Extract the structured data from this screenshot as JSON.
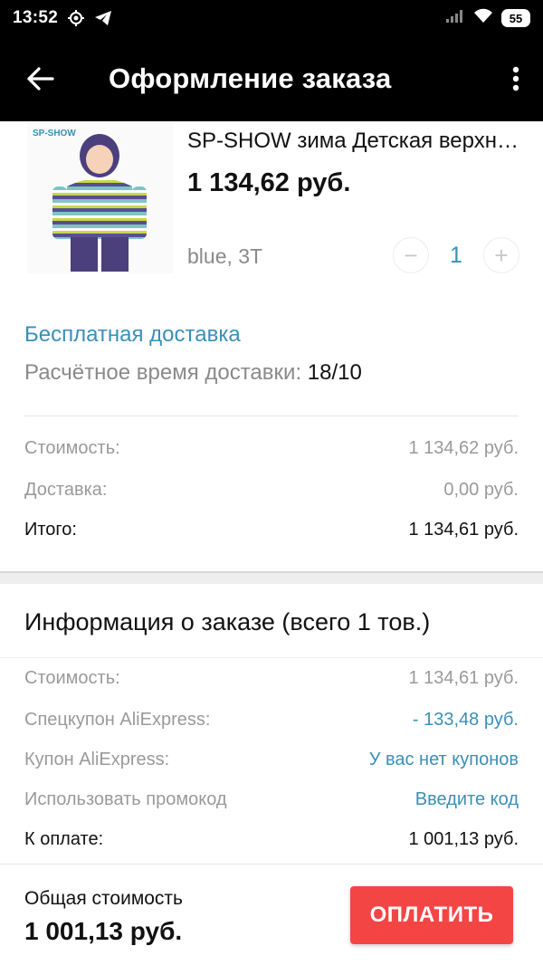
{
  "status_bar": {
    "time": "13:52",
    "battery": "55",
    "icons": [
      "settings-gear-icon",
      "telegram-icon",
      "signal-icon",
      "wifi-icon",
      "battery-icon"
    ]
  },
  "app_bar": {
    "title": "Оформление заказа",
    "back_icon": "arrow-left-icon",
    "more_icon": "more-vertical-icon"
  },
  "product": {
    "brand_logo_text": "SP-SHOW",
    "name": "SP-SHOW зима Детская верхняя одежда",
    "price": "1 134,62 руб.",
    "variant": "blue, 3T",
    "quantity": "1",
    "minus": "−",
    "plus": "+"
  },
  "shipping": {
    "method": "Бесплатная доставка",
    "eta_label": "Расчётное время доставки:",
    "eta_value": "18/10"
  },
  "item_summary": {
    "cost_label": "Стоимость:",
    "cost_value": "1 134,62 руб.",
    "delivery_label": "Доставка:",
    "delivery_value": "0,00 руб.",
    "total_label": "Итого:",
    "total_value": "1 134,61 руб."
  },
  "order_info": {
    "title": "Информация о заказе (всего 1 тов.)",
    "cost_label": "Стоимость:",
    "cost_value": "1 134,61 руб.",
    "special_coupon_label": "Спецкупон AliExpress:",
    "special_coupon_value": "- 133,48 руб.",
    "coupon_label": "Купон AliExpress:",
    "coupon_value": "У вас нет купонов",
    "promo_label": "Использовать промокод",
    "promo_value": "Введите код",
    "to_pay_label": "К оплате:",
    "to_pay_value": "1 001,13 руб."
  },
  "footer": {
    "total_label": "Общая стоимость",
    "total_value": "1 001,13 руб.",
    "pay_button": "ОПЛАТИТЬ"
  },
  "colors": {
    "accent_blue": "#3a8fb7",
    "pay_red": "#f44545",
    "header_black": "#000000",
    "muted_gray": "#9a9a9a"
  }
}
